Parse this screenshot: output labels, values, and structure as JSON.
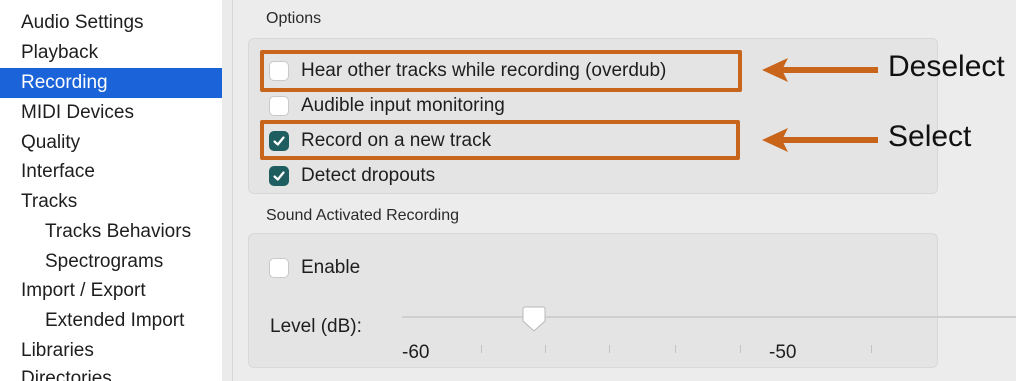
{
  "sidebar": {
    "items": [
      {
        "label": "Audio Settings"
      },
      {
        "label": "Playback"
      },
      {
        "label": "Recording",
        "selected": true
      },
      {
        "label": "MIDI Devices"
      },
      {
        "label": "Quality"
      },
      {
        "label": "Interface"
      },
      {
        "label": "Tracks"
      },
      {
        "label": "Tracks Behaviors",
        "sub": true
      },
      {
        "label": "Spectrograms",
        "sub": true
      },
      {
        "label": "Import / Export"
      },
      {
        "label": "Extended Import",
        "sub": true
      },
      {
        "label": "Libraries"
      },
      {
        "label": "Directories"
      }
    ]
  },
  "options": {
    "title": "Options",
    "hear_other_tracks": {
      "label": "Hear other tracks while recording (overdub)",
      "checked": false
    },
    "audible_input_monitoring": {
      "label": "Audible input monitoring",
      "checked": false
    },
    "record_new_track": {
      "label": "Record on a new track",
      "checked": true
    },
    "detect_dropouts": {
      "label": "Detect dropouts",
      "checked": true
    }
  },
  "sound_activated": {
    "title": "Sound Activated Recording",
    "enable": {
      "label": "Enable",
      "checked": false
    },
    "level_label": "Level (dB):",
    "tick_labels": [
      "-60",
      "-50"
    ]
  },
  "annotations": {
    "deselect": "Deselect",
    "select": "Select",
    "color": "#c8651b"
  },
  "colors": {
    "selection": "#1b63d8",
    "checkbox_checked": "#1e5e61"
  }
}
